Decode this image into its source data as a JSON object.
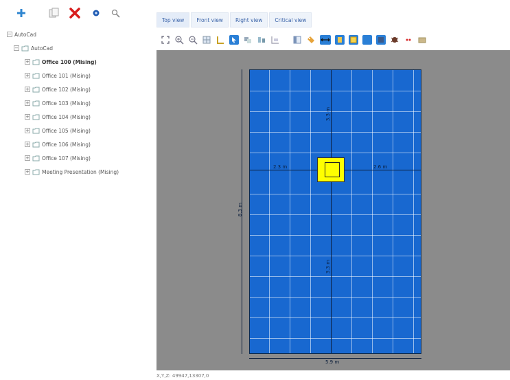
{
  "left_toolbar": {
    "icons": [
      "plus-icon",
      "copy-icon",
      "delete-icon",
      "settings-icon",
      "search-icon"
    ]
  },
  "tree": {
    "root": "AutoCad",
    "child": "AutoCad",
    "items": [
      {
        "label": "Office 100 (Mising)",
        "bold": true
      },
      {
        "label": "Office 101 (Mising)"
      },
      {
        "label": "Office 102 (Mising)"
      },
      {
        "label": "Office 103 (Mising)"
      },
      {
        "label": "Office 104 (Mising)"
      },
      {
        "label": "Office 105 (Mising)"
      },
      {
        "label": "Office 106 (Mising)"
      },
      {
        "label": "Office 107 (Mising)"
      },
      {
        "label": "Meeting Presentation (Mising)"
      }
    ]
  },
  "tabs": [
    "Top view",
    "Front view",
    "Right view",
    "Critical view"
  ],
  "active_tab": "Top view",
  "view_toolbar": {
    "icons": [
      "zoom-extents-icon",
      "zoom-in-icon",
      "zoom-out-icon",
      "grid-icon",
      "measure-icon",
      "select-icon",
      "snap-icon",
      "align-icon",
      "layout-icon",
      "panel-icon",
      "tag-icon",
      "dimension-icon",
      "light-icon",
      "sun-icon",
      "layer-icon",
      "view3d-icon",
      "render-icon",
      "link-icon",
      "image-icon"
    ]
  },
  "viewport": {
    "dims": {
      "top": "3.3 m",
      "bottom": "3.3 m",
      "left": "2.3 m",
      "right": "2.6 m",
      "total_height": "8.3 m",
      "total_width": "5.9 m"
    },
    "colors": {
      "background": "#8b8b8b",
      "room": "#1868d0",
      "object": "#ffff00"
    }
  },
  "status": "X,Y,Z: 49947,13307,0"
}
